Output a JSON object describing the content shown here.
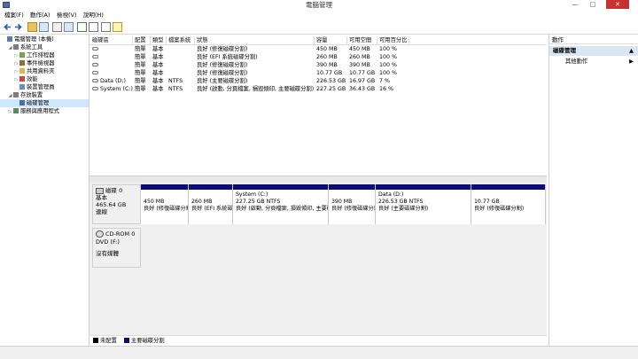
{
  "window": {
    "title": "電腦管理",
    "minimize": "—",
    "maximize": "□",
    "close": "✕"
  },
  "menu": [
    "檔案(F)",
    "動作(A)",
    "檢視(V)",
    "說明(H)"
  ],
  "tree": [
    {
      "label": "電腦管理 (本機)",
      "level": 0,
      "arrow": ""
    },
    {
      "label": "系統工具",
      "level": 1,
      "arrow": "◢"
    },
    {
      "label": "工作排程器",
      "level": 2,
      "arrow": "▷"
    },
    {
      "label": "事件檢視器",
      "level": 2,
      "arrow": "▷"
    },
    {
      "label": "共用資料夾",
      "level": 2,
      "arrow": "▷"
    },
    {
      "label": "效能",
      "level": 2,
      "arrow": "▷"
    },
    {
      "label": "裝置管理員",
      "level": 2,
      "arrow": ""
    },
    {
      "label": "存放裝置",
      "level": 1,
      "arrow": "◢"
    },
    {
      "label": "磁碟管理",
      "level": 2,
      "arrow": "",
      "selected": true
    },
    {
      "label": "服務與應用程式",
      "level": 1,
      "arrow": "▷"
    }
  ],
  "columns": [
    "磁碟區",
    "配置",
    "類型",
    "檔案系統",
    "狀態",
    "容量",
    "可用空間",
    "可用百分比"
  ],
  "volumes": [
    [
      "",
      "簡單",
      "基本",
      "",
      "良好 (修復磁碟分割)",
      "450 MB",
      "450 MB",
      "100 %"
    ],
    [
      "",
      "簡單",
      "基本",
      "",
      "良好 (EFI 系統磁碟分割)",
      "260 MB",
      "260 MB",
      "100 %"
    ],
    [
      "",
      "簡單",
      "基本",
      "",
      "良好 (修復磁碟分割)",
      "390 MB",
      "390 MB",
      "100 %"
    ],
    [
      "",
      "簡單",
      "基本",
      "",
      "良好 (修復磁碟分割)",
      "10.77 GB",
      "10.77 GB",
      "100 %"
    ],
    [
      "Data (D:)",
      "簡單",
      "基本",
      "NTFS",
      "良好 (主要磁碟分割)",
      "226.53 GB",
      "16.97 GB",
      "7 %"
    ],
    [
      "System (C:)",
      "簡單",
      "基本",
      "NTFS",
      "良好 (啟動, 分頁檔案, 損毀傾印, 主要磁碟分割)",
      "227.25 GB",
      "36.43 GB",
      "16 %"
    ]
  ],
  "disk0": {
    "name": "磁碟 0",
    "type": "基本",
    "size": "465.64 GB",
    "state": "連線",
    "partitions": [
      {
        "name": "",
        "size": "450 MB",
        "status": "良好 (修復磁碟分割)"
      },
      {
        "name": "",
        "size": "260 MB",
        "status": "良好 (EFI 系統磁碟分割)"
      },
      {
        "name": "System  (C:)",
        "size": "227.25 GB NTFS",
        "status": "良好 (啟動, 分頁檔案, 損毀傾印, 主要磁碟分割)"
      },
      {
        "name": "",
        "size": "390 MB",
        "status": "良好 (修復磁碟分割)"
      },
      {
        "name": "Data  (D:)",
        "size": "226.53 GB NTFS",
        "status": "良好 (主要磁碟分割)"
      },
      {
        "name": "",
        "size": "10.77 GB",
        "status": "良好 (修復磁碟分割)"
      }
    ]
  },
  "cdrom": {
    "name": "CD-ROM 0",
    "drive": "DVD (F:)",
    "media": "沒有媒體"
  },
  "legend": [
    {
      "label": "未配置",
      "color": "#000000"
    },
    {
      "label": "主要磁碟分割",
      "color": "#0b0b7a"
    }
  ],
  "actions": {
    "header": "動作",
    "section": "磁碟管理",
    "more": "其他動作"
  }
}
